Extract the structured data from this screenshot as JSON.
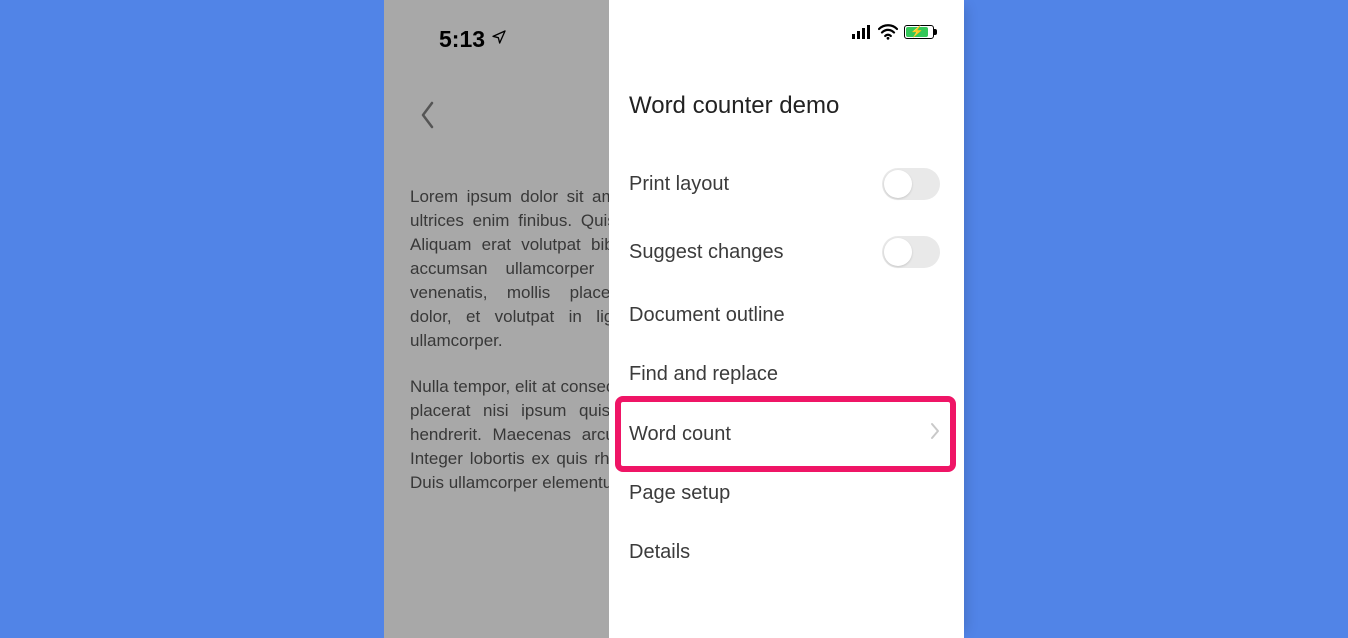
{
  "status": {
    "time": "5:13",
    "location_icon": "location-arrow-icon",
    "cellular": "cell-bars-icon",
    "wifi": "wifi-icon",
    "battery": "battery-charging-icon"
  },
  "document": {
    "back_icon": "chevron-left-icon",
    "paragraph1": "Lorem ipsum dolor sit amet. Etiam ut ultrices enim finibus. Quisque a ante. Aliquam erat volutpat bibendum arcu accumsan ullamcorper in a dolor venenatis, mollis placerat aliquam dolor, et volutpat in ligula ultrices, ullamcorper.",
    "paragraph2": "Nulla tempor, elit at consectetur gravida placerat nisi ipsum quis aliquet eu, hendrerit. Maecenas arcu risus, sed. Integer lobortis ex quis rhoncus quam. Duis ullamcorper elementum."
  },
  "panel": {
    "title": "Word counter demo",
    "items": [
      {
        "label": "Print layout",
        "type": "toggle",
        "value": false
      },
      {
        "label": "Suggest changes",
        "type": "toggle",
        "value": false
      },
      {
        "label": "Document outline",
        "type": "nav"
      },
      {
        "label": "Find and replace",
        "type": "nav"
      },
      {
        "label": "Word count",
        "type": "nav",
        "highlighted": true,
        "chevron": true
      },
      {
        "label": "Page setup",
        "type": "nav"
      },
      {
        "label": "Details",
        "type": "nav"
      }
    ]
  },
  "colors": {
    "page_bg": "#5184e7",
    "highlight": "#ef1566",
    "battery_fill": "#35c759"
  }
}
